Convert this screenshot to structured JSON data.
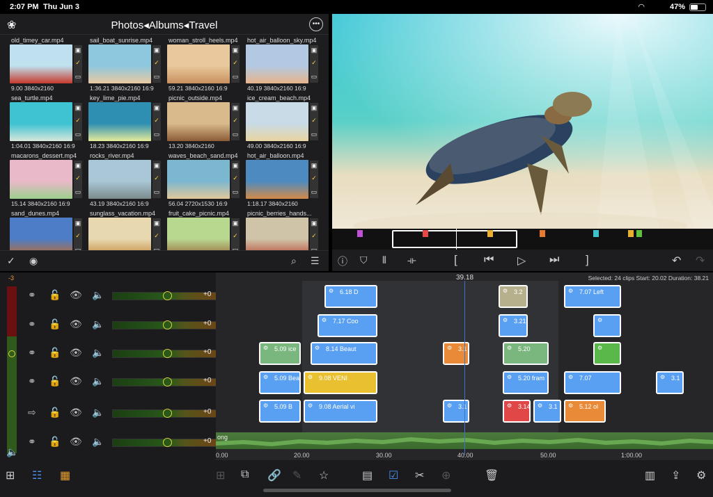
{
  "status_bar": {
    "time": "2:07 PM",
    "date": "Thu Jun 3",
    "battery": "47%"
  },
  "browser": {
    "breadcrumb": "Photos◂Albums◂Travel",
    "clips": [
      {
        "name": "old_timey_car.mp4",
        "meta": "9.00  3840x2160",
        "colors": [
          "#bfe0ee",
          "#c73a2c"
        ]
      },
      {
        "name": "sail_boat_sunrise.mp4",
        "meta": "1:36.21  3840x2160  16:9",
        "colors": [
          "#8ec8df",
          "#e9c9a0"
        ]
      },
      {
        "name": "woman_stroll_heels.mp4",
        "meta": "59.21  3840x2160  16:9",
        "colors": [
          "#e8c89c",
          "#c8905e"
        ]
      },
      {
        "name": "hot_air_balloon_sky.mp4",
        "meta": "40.19  3840x2160  16:9",
        "colors": [
          "#b3c9e3",
          "#e7b48a"
        ]
      },
      {
        "name": "sea_turtle.mp4",
        "meta": "1:04.01  3840x2160  16:9",
        "colors": [
          "#3dc3d2",
          "#d8e6da"
        ]
      },
      {
        "name": "key_lime_pie.mp4",
        "meta": "18.23  3840x2160  16:9",
        "colors": [
          "#2f8fb3",
          "#e6ec9a"
        ]
      },
      {
        "name": "picnic_outside.mp4",
        "meta": "13.20  3840x2160",
        "colors": [
          "#d8ba8c",
          "#8c5b36"
        ]
      },
      {
        "name": "ice_cream_beach.mp4",
        "meta": "49.00  3840x2160  16:9",
        "colors": [
          "#c8dbe6",
          "#e8d4a0"
        ]
      },
      {
        "name": "macarons_dessert.mp4",
        "meta": "15.14  3840x2160  16:9",
        "colors": [
          "#e9b8c9",
          "#9ccf8c"
        ]
      },
      {
        "name": "rocks_river.mp4",
        "meta": "43.19  3840x2160  16:9",
        "colors": [
          "#a9c7d6",
          "#7b8a8c"
        ]
      },
      {
        "name": "waves_beach_sand.mp4",
        "meta": "56.04  2720x1530  16:9",
        "colors": [
          "#7cb7d0",
          "#e2c89a"
        ]
      },
      {
        "name": "hot_air_balloon.mp4",
        "meta": "1:18.17  3840x2160",
        "colors": [
          "#4d8ac0",
          "#d28a48"
        ]
      },
      {
        "name": "sand_dunes.mp4",
        "meta": "",
        "colors": [
          "#4d7dc6",
          "#c06a2c"
        ]
      },
      {
        "name": "sunglass_vacation.mp4",
        "meta": "",
        "colors": [
          "#e8d8b0",
          "#c38a40"
        ]
      },
      {
        "name": "fruit_cake_picnic.mp4",
        "meta": "",
        "colors": [
          "#b8d890",
          "#9a6a3c"
        ]
      },
      {
        "name": "picnic_berries_hands...",
        "meta": "",
        "colors": [
          "#d0c4a8",
          "#b8503c"
        ]
      }
    ]
  },
  "timeline": {
    "timecode": "39.18",
    "info": "Selected: 24 clips Start: 20.02 Duration: 38.21",
    "audio_label": "ong",
    "ruler": [
      "0.00",
      "20.00",
      "30.00",
      "40.00",
      "50.00",
      "1:00.00"
    ],
    "lanes": [
      {
        "value": "+0",
        "level": -3
      },
      {
        "value": "+0"
      },
      {
        "value": "+0"
      },
      {
        "value": "+0"
      },
      {
        "value": "+0"
      },
      {
        "value": "+0"
      }
    ],
    "meter_label": "-3",
    "clips": [
      {
        "label": "6.18  D",
        "color": "#5aa0f2"
      },
      {
        "label": "3.2",
        "color": "#b6b08c"
      },
      {
        "label": "7.07  Left",
        "color": "#5aa0f2"
      },
      {
        "label": "7.17  Coo",
        "color": "#5aa0f2"
      },
      {
        "label": "3.21",
        "color": "#5aa0f2"
      },
      {
        "label": "",
        "color": "#5aa0f2"
      },
      {
        "label": "5.09  ice",
        "color": "#79b77e"
      },
      {
        "label": "8.14  Beaut",
        "color": "#5aa0f2"
      },
      {
        "label": "3.1",
        "color": "#e88a38"
      },
      {
        "label": "5.20",
        "color": "#79b77e"
      },
      {
        "label": "",
        "color": "#5ab84a"
      },
      {
        "label": "5.09  Bea",
        "color": "#5aa0f2"
      },
      {
        "label": "9.08  VENI",
        "color": "#e8c030"
      },
      {
        "label": "5.20  fram",
        "color": "#5aa0f2"
      },
      {
        "label": "7.07",
        "color": "#5aa0f2"
      },
      {
        "label": "3.1",
        "color": "#5aa0f2"
      },
      {
        "label": "5.09  B",
        "color": "#5aa0f2"
      },
      {
        "label": "9.08  Aerial vi",
        "color": "#5aa0f2"
      },
      {
        "label": "3.1",
        "color": "#5aa0f2"
      },
      {
        "label": "3.14",
        "color": "#e04848"
      },
      {
        "label": "3.1",
        "color": "#5aa0f2"
      },
      {
        "label": "5.12  ol",
        "color": "#e88a38"
      }
    ]
  }
}
